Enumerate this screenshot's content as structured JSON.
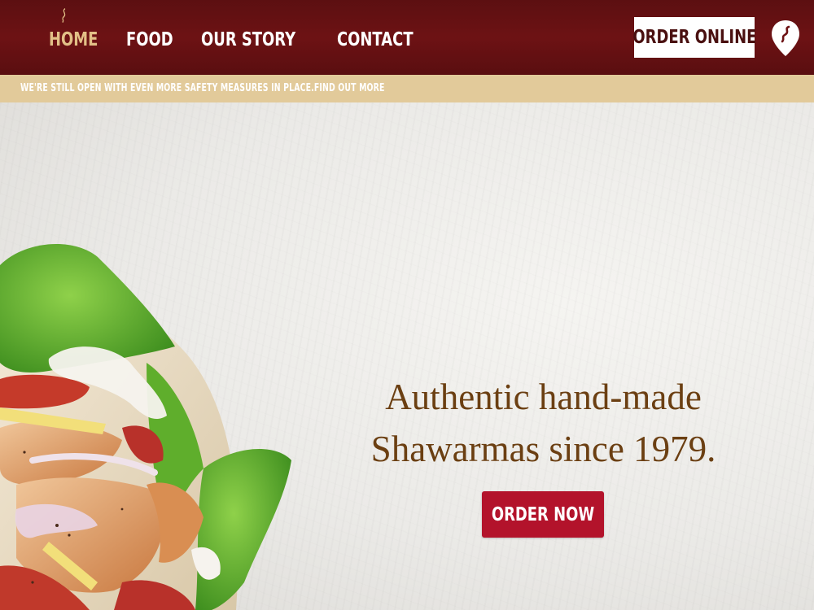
{
  "nav": {
    "items": [
      {
        "label": "HOME",
        "active": true
      },
      {
        "label": "FOOD",
        "active": false
      },
      {
        "label": "OUR STORY",
        "active": false
      },
      {
        "label": "CONTACT",
        "active": false
      }
    ],
    "order_online_label": "ORDER ONLINE",
    "icons": {
      "active_marker": "steam-icon",
      "location": "map-pin-icon"
    }
  },
  "notice": {
    "text": "WE'RE STILL OPEN WITH EVEN MORE SAFETY MEASURES IN PLACE.",
    "link_label": "FIND OUT MORE"
  },
  "hero": {
    "headline_line1": "Authentic hand-made",
    "headline_line2": "Shawarmas since 1979.",
    "cta_label": "ORDER NOW",
    "image": "shawarma-wrap-image"
  },
  "colors": {
    "header_bg": "#6d1214",
    "nav_active": "#e2c087",
    "notice_bg": "#e2ca9a",
    "headline": "#6b3f12",
    "cta_bg": "#b3132b"
  }
}
